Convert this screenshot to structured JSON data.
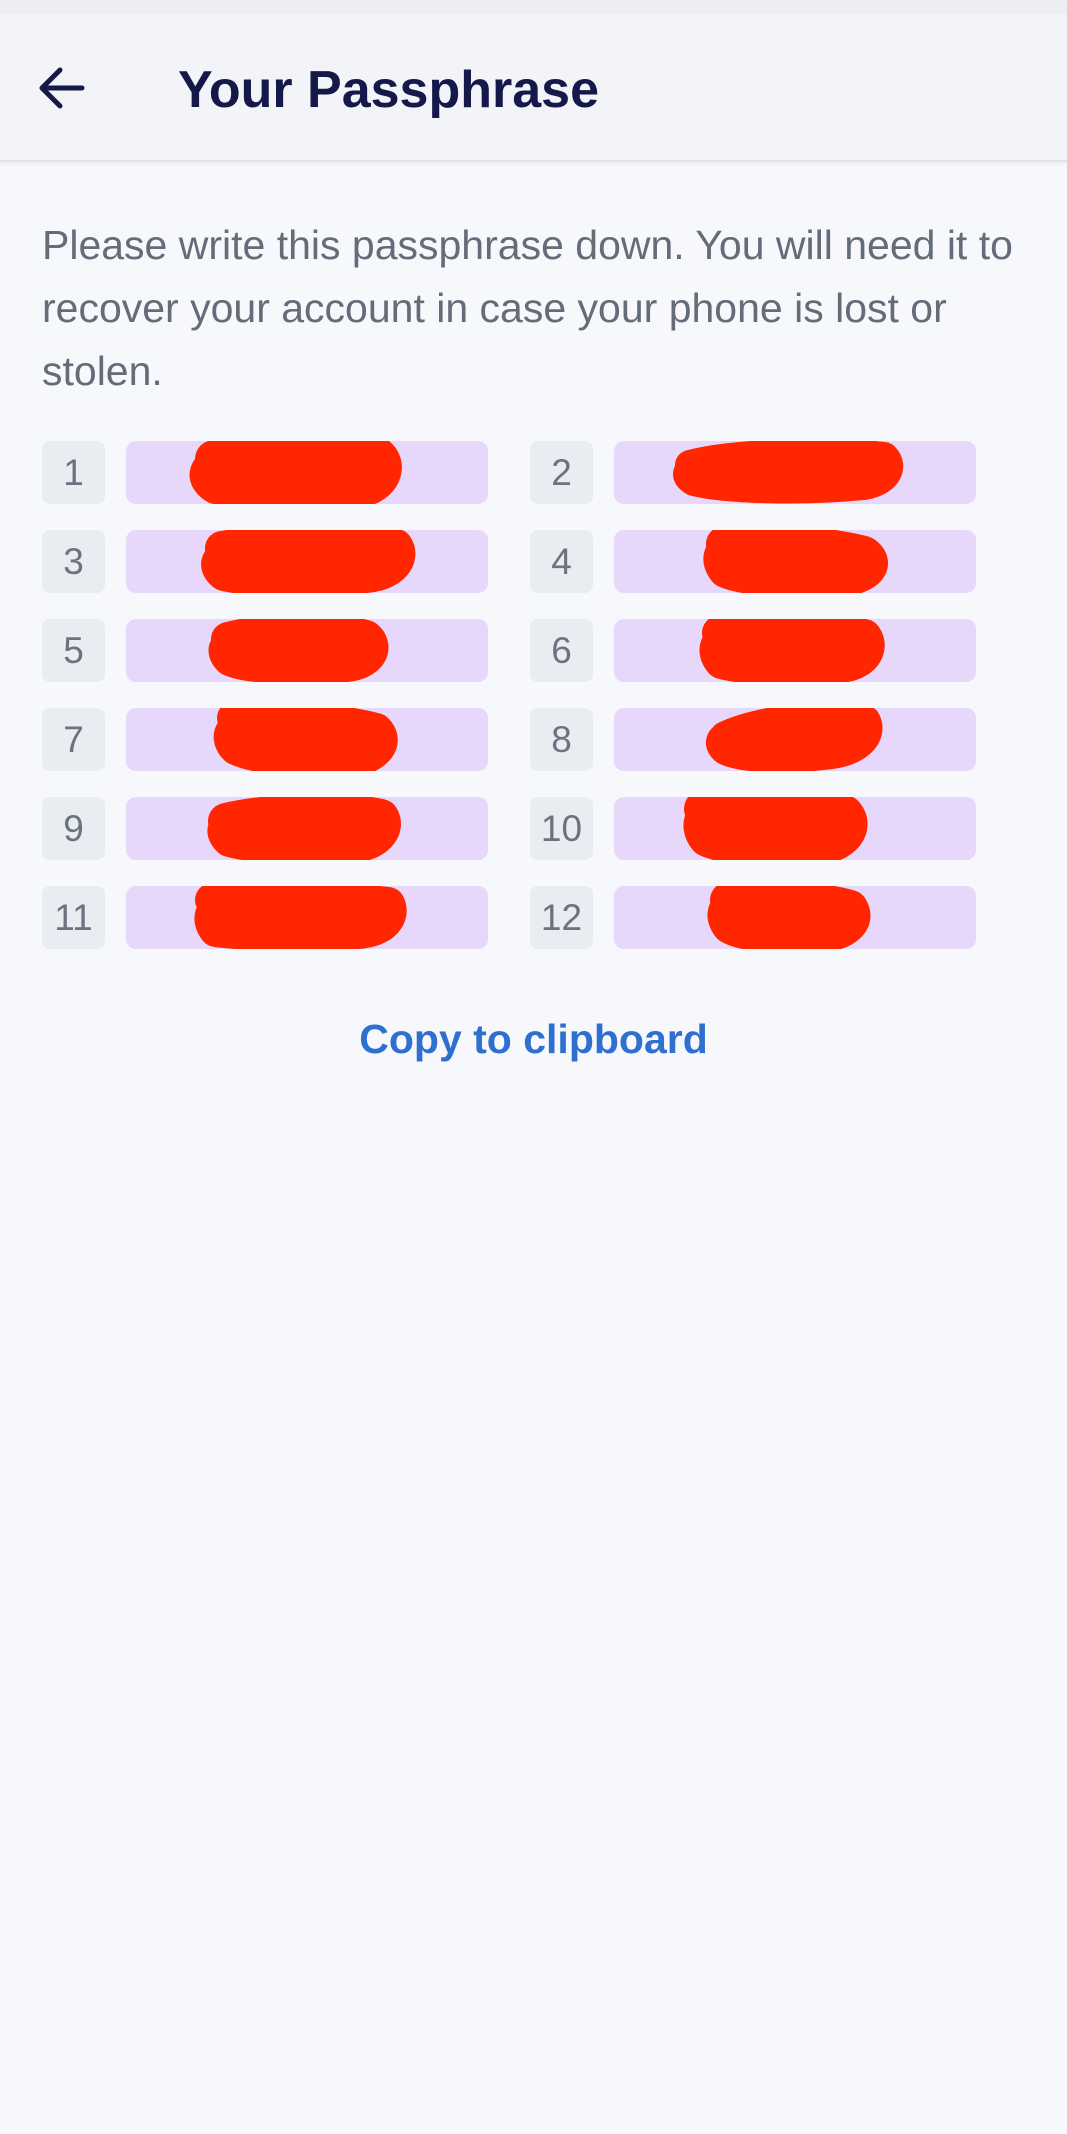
{
  "header": {
    "back_icon": "arrow-left-icon",
    "title": "Your Passphrase"
  },
  "instructions": "Please write this passphrase down. You will need it to recover your account in case your phone is lost or stolen.",
  "passphrase": {
    "words": [
      {
        "index": "1",
        "word": "[redacted]"
      },
      {
        "index": "2",
        "word": "[redacted]"
      },
      {
        "index": "3",
        "word": "[redacted]"
      },
      {
        "index": "4",
        "word": "[redacted]"
      },
      {
        "index": "5",
        "word": "[redacted]"
      },
      {
        "index": "6",
        "word": "[redacted]"
      },
      {
        "index": "7",
        "word": "[redacted]"
      },
      {
        "index": "8",
        "word": "[redacted]"
      },
      {
        "index": "9",
        "word": "[redacted]"
      },
      {
        "index": "10",
        "word": "[redacted]"
      },
      {
        "index": "11",
        "word": "[redacted]"
      },
      {
        "index": "12",
        "word": "[redacted]"
      }
    ]
  },
  "actions": {
    "copy_label": "Copy to clipboard"
  },
  "colors": {
    "title": "#14194a",
    "accent": "#2f6fd0",
    "word_chip": "#e7d8fb",
    "redaction": "#ff2600"
  }
}
